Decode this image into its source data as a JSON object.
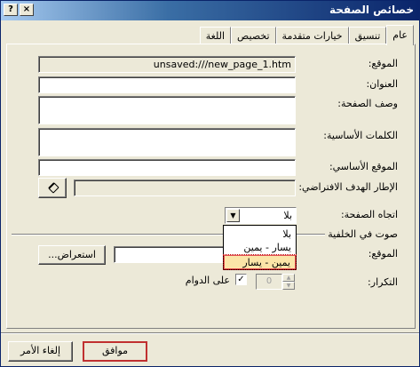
{
  "window": {
    "title": "خصائص الصفحة",
    "help_label": "?",
    "close_label": "×"
  },
  "tabs": [
    {
      "label": "عام",
      "active": true
    },
    {
      "label": "تنسيق",
      "active": false
    },
    {
      "label": "خيارات متقدمة",
      "active": false
    },
    {
      "label": "تخصيص",
      "active": false
    },
    {
      "label": "اللغة",
      "active": false
    }
  ],
  "general": {
    "location_label": "الموقع:",
    "location_value": "unsaved:///new_page_1.htm",
    "title_label": "العنوان:",
    "title_value": "",
    "description_label": "وصف الصفحة:",
    "description_value": "",
    "keywords_label": "الكلمات الأساسية:",
    "keywords_value": "",
    "base_location_label": "الموقع الأساسي:",
    "base_location_value": "",
    "default_target_label": "الإطار الهدف الافتراضي:",
    "default_target_value": "",
    "target_browse_icon": "pencil-icon",
    "target_browse_label": "..."
  },
  "direction": {
    "label": "اتجاه الصفحة:",
    "selected": "بلا",
    "options": [
      "بلا",
      "يسار - يمين",
      "يمين - يسار"
    ],
    "highlighted_index": 2
  },
  "background_sound": {
    "group_label": "صوت في الخلفية",
    "location_label": "الموقع:",
    "location_value": "",
    "browse_label": "استعراض...",
    "loop_label": "التكرار:",
    "loop_value": "0",
    "forever_label": "على الدوام",
    "forever_checked": true
  },
  "buttons": {
    "ok_label": "موافق",
    "cancel_label": "إلغاء الأمر"
  }
}
